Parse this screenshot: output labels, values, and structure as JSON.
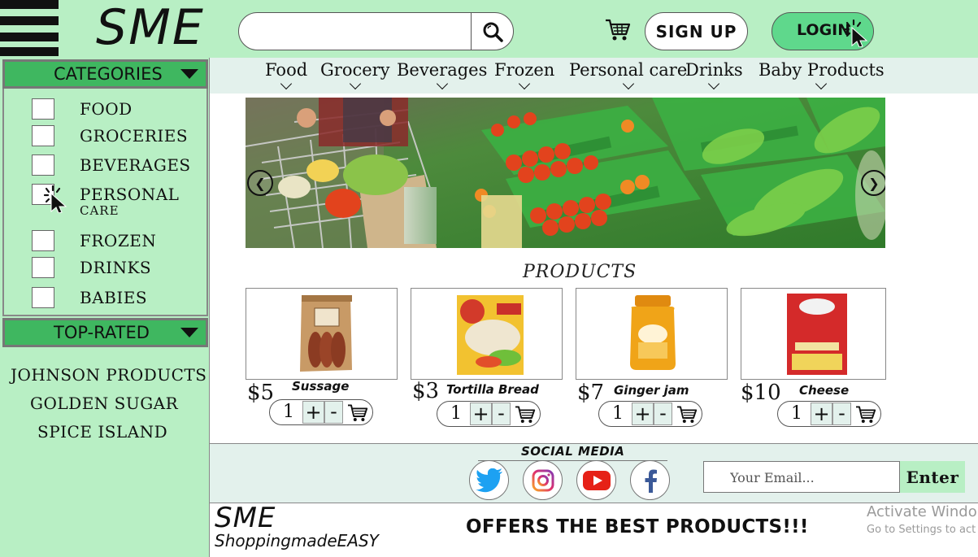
{
  "header": {
    "logo": "SME",
    "search_placeholder": "",
    "signup_label": "SIGN UP",
    "login_label": "LOGIN"
  },
  "sidebar": {
    "categories_title": "CATEGORIES",
    "categories": [
      {
        "label": "FOOD"
      },
      {
        "label": "GROCERIES"
      },
      {
        "label": "BEVERAGES"
      },
      {
        "label": "PERSONAL",
        "sub": "CARE"
      },
      {
        "label": "FROZEN"
      },
      {
        "label": "DRINKS"
      },
      {
        "label": "BABIES"
      }
    ],
    "top_rated_title": "TOP-RATED",
    "brands": [
      "JOHNSON PRODUCTS",
      "GOLDEN SUGAR",
      "SPICE ISLAND"
    ]
  },
  "nav": {
    "items": [
      "Food",
      "Grocery",
      "Beverages",
      "Frozen",
      "Personal care",
      "Drinks",
      "Baby Products"
    ]
  },
  "products": {
    "title": "PRODUCTS",
    "items": [
      {
        "price": "$5",
        "name": "Sussage",
        "qty": "1"
      },
      {
        "price": "$3",
        "name": "Tortilla Bread",
        "qty": "1"
      },
      {
        "price": "$7",
        "name": "Ginger jam",
        "qty": "1"
      },
      {
        "price": "$10",
        "name": "Cheese",
        "qty": "1"
      }
    ],
    "plus": "+",
    "minus": "-"
  },
  "social": {
    "title": "SOCIAL MEDIA",
    "icons": [
      "twitter-icon",
      "instagram-icon",
      "youtube-icon",
      "facebook-icon"
    ],
    "email_placeholder": "Your Email...",
    "enter_label": "Enter"
  },
  "footer": {
    "logo": "SME",
    "tagline": "ShoppingmadeEASY",
    "offer": "OFFERS THE BEST PRODUCTS!!!",
    "activate_title": "Activate Windo",
    "activate_sub": "Go to Settings to act"
  },
  "colors": {
    "mint": "#b8efc4",
    "green": "#3fb760",
    "login_green": "#5fd88c",
    "pale": "#e3f1ec"
  }
}
